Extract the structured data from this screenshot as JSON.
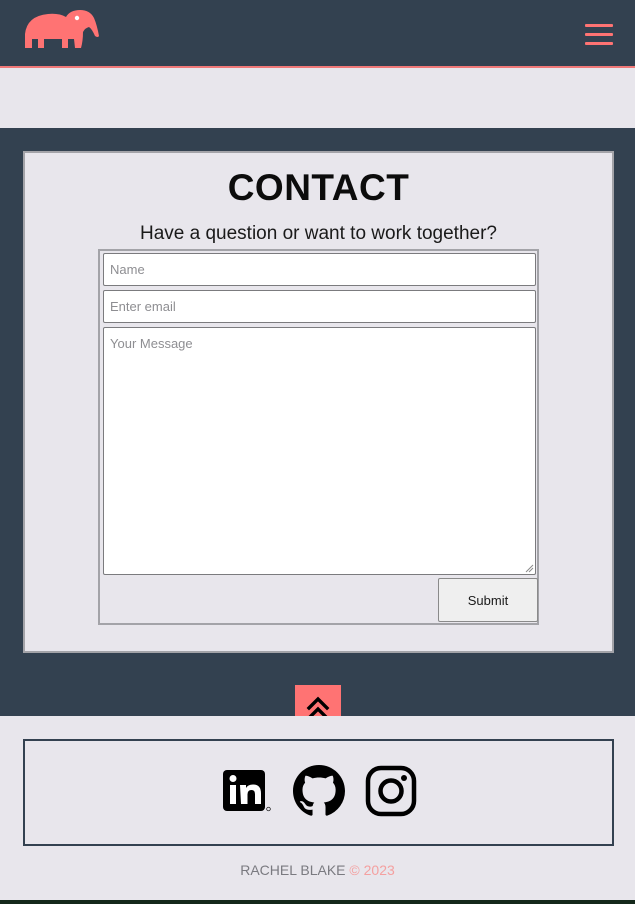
{
  "navbar": {
    "logo_icon": "anteater-logo-icon",
    "menu_icon": "hamburger-menu-icon",
    "accent_color": "#ff7373",
    "background_color": "#334150"
  },
  "contact": {
    "title": "CONTACT",
    "subtitle": "Have a question or want to work together?",
    "name_placeholder": "Name",
    "email_placeholder": "Enter email",
    "message_placeholder": "Your Message",
    "submit_label": "Submit"
  },
  "back_to_top": {
    "icon": "double-chevron-up-icon"
  },
  "footer": {
    "social_links": [
      {
        "name": "LinkedIn",
        "icon": "linkedin-icon"
      },
      {
        "name": "GitHub",
        "icon": "github-icon"
      },
      {
        "name": "Instagram",
        "icon": "instagram-icon"
      }
    ],
    "copyright_name": "RACHEL BLAKE",
    "copyright_year": "© 2023"
  }
}
